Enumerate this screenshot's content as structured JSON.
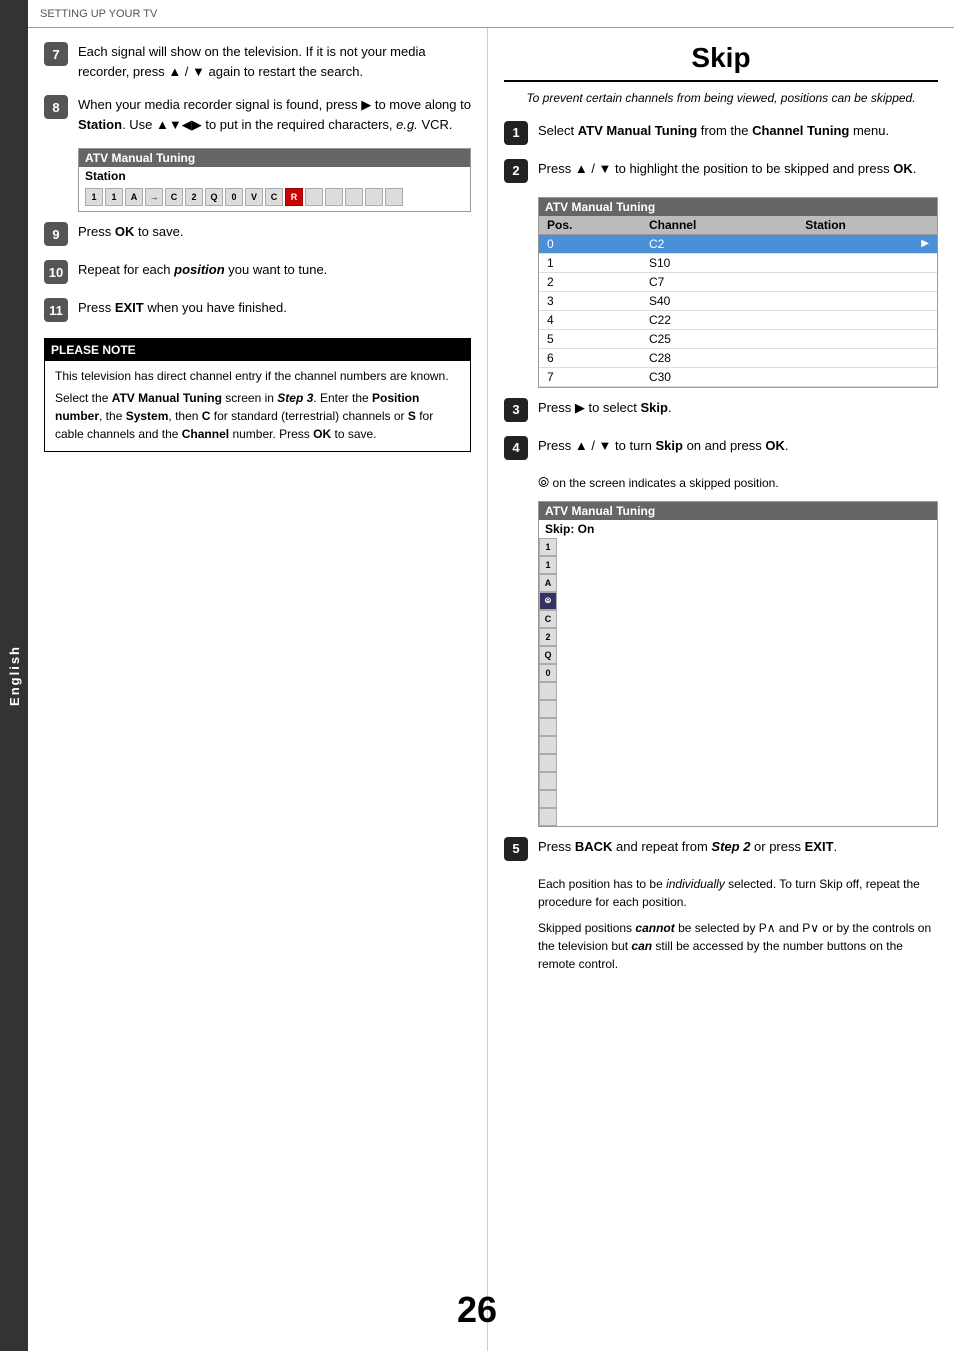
{
  "header": {
    "title": "SETTING UP YOUR TV"
  },
  "sidebar": {
    "label": "English"
  },
  "left_column": {
    "steps": [
      {
        "number": "7",
        "text": "Each signal will show on the television. If it is not your media recorder, press ▲ / ▼ again to restart the search."
      },
      {
        "number": "8",
        "text_parts": [
          "When your media recorder signal is found, press ▶ to move along to ",
          "Station",
          ". Use ▲▼◀▶ to put in the required characters, ",
          "e.g.",
          " VCR."
        ]
      },
      {
        "number": "9",
        "text_parts": [
          "Press ",
          "OK",
          " to save."
        ]
      },
      {
        "number": "10",
        "text_parts": [
          "Repeat for each ",
          "position",
          " you want to tune."
        ]
      },
      {
        "number": "11",
        "text_parts": [
          "Press ",
          "EXIT",
          " when you have finished."
        ]
      }
    ],
    "atv_box": {
      "title": "ATV Manual Tuning",
      "label": "Station",
      "keys": [
        "1",
        "1",
        "A",
        "→",
        "C",
        "2",
        "Q",
        "0",
        "V",
        "C",
        "R",
        "",
        "",
        "",
        "",
        ""
      ]
    },
    "note": {
      "title": "PLEASE NOTE",
      "lines": [
        "This television has direct channel entry if the channel numbers are known.",
        "Select the ATV Manual Tuning screen in Step 3. Enter the Position number, the System, then C for standard (terrestrial) channels or S for cable channels and the Channel number. Press OK to save."
      ]
    }
  },
  "right_column": {
    "title": "Skip",
    "subtitle": "To prevent certain channels from being viewed, positions can be skipped.",
    "steps": [
      {
        "number": "1",
        "text_parts": [
          "Select ",
          "ATV Manual Tuning",
          " from the ",
          "Channel Tuning",
          " menu."
        ]
      },
      {
        "number": "2",
        "text_parts": [
          "Press ▲ / ▼ to highlight the position to be skipped and press ",
          "OK",
          "."
        ]
      },
      {
        "number": "3",
        "text_parts": [
          "Press ▶ to select ",
          "Skip",
          "."
        ]
      },
      {
        "number": "4",
        "text_parts": [
          "Press ▲ / ▼ to turn ",
          "Skip",
          " on and press ",
          "OK",
          "."
        ]
      },
      {
        "number": "5",
        "text_parts": [
          "Press ",
          "BACK",
          " and repeat from ",
          "Step 2",
          " or press ",
          "EXIT",
          "."
        ]
      }
    ],
    "atv_table": {
      "title": "ATV Manual Tuning",
      "columns": [
        "Pos.",
        "Channel",
        "Station"
      ],
      "rows": [
        {
          "pos": "0",
          "channel": "C2",
          "station": "",
          "selected": true
        },
        {
          "pos": "1",
          "channel": "S10",
          "station": ""
        },
        {
          "pos": "2",
          "channel": "C7",
          "station": ""
        },
        {
          "pos": "3",
          "channel": "S40",
          "station": ""
        },
        {
          "pos": "4",
          "channel": "C22",
          "station": ""
        },
        {
          "pos": "5",
          "channel": "C25",
          "station": ""
        },
        {
          "pos": "6",
          "channel": "C28",
          "station": ""
        },
        {
          "pos": "7",
          "channel": "C30",
          "station": ""
        }
      ]
    },
    "skip_icon_note": "⦾ on the screen indicates a skipped position.",
    "skip_on_box": {
      "title": "ATV Manual Tuning",
      "label": "Skip: On"
    },
    "step5_extra": [
      "Each position has to be individually selected. To turn Skip off, repeat the procedure for each position.",
      "Skipped positions cannot be selected by P∧ and P∨ or by the controls on the television but can still be accessed by the number buttons on the remote control."
    ]
  },
  "page_number": "26"
}
